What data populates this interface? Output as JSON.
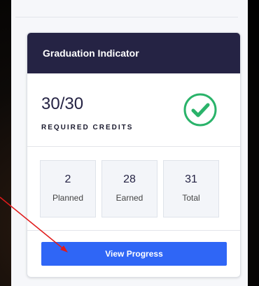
{
  "card": {
    "title": "Graduation Indicator",
    "credits_value": "30/30",
    "credits_label": "REQUIRED CREDITS",
    "status_icon": "check-circle-icon",
    "accent_color": "#2f66f6",
    "header_color": "#252344",
    "success_color": "#2ab36a"
  },
  "stats": [
    {
      "value": "2",
      "label": "Planned"
    },
    {
      "value": "28",
      "label": "Earned"
    },
    {
      "value": "31",
      "label": "Total"
    }
  ],
  "actions": {
    "view_progress_label": "View Progress"
  },
  "annotation": {
    "type": "red-arrow",
    "color": "#e01b1b"
  }
}
